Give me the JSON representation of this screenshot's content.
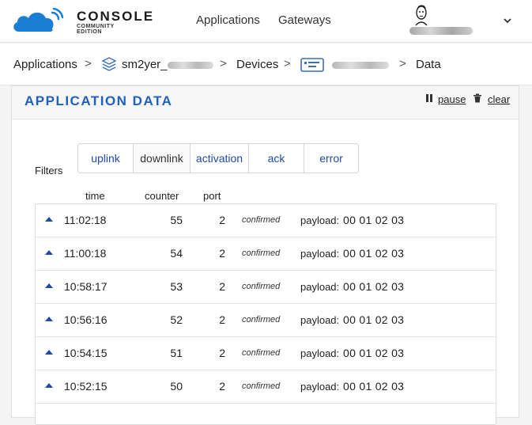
{
  "brand": {
    "title": "CONSOLE",
    "sub1": "COMMUNITY",
    "sub2": "EDITION",
    "accent": "#1a7fd4"
  },
  "nav": {
    "applications": "Applications",
    "gateways": "Gateways"
  },
  "breadcrumb": {
    "applications": "Applications",
    "app_id": "sm2yer_",
    "devices": "Devices",
    "data": "Data"
  },
  "panel": {
    "title": "APPLICATION DATA",
    "pause": "pause",
    "clear": "clear",
    "title_color": "#2060c0"
  },
  "filters": {
    "label": "Filters",
    "options": [
      "uplink",
      "downlink",
      "activation",
      "ack",
      "error"
    ],
    "active": "downlink"
  },
  "columns": {
    "time": "time",
    "counter": "counter",
    "port": "port"
  },
  "rows": [
    {
      "time": "11:02:18",
      "counter": "55",
      "port": "2",
      "confirmed": "confirmed",
      "payload_label": "payload:",
      "payload": "00 01 02 03"
    },
    {
      "time": "11:00:18",
      "counter": "54",
      "port": "2",
      "confirmed": "confirmed",
      "payload_label": "payload:",
      "payload": "00 01 02 03"
    },
    {
      "time": "10:58:17",
      "counter": "53",
      "port": "2",
      "confirmed": "confirmed",
      "payload_label": "payload:",
      "payload": "00 01 02 03"
    },
    {
      "time": "10:56:16",
      "counter": "52",
      "port": "2",
      "confirmed": "confirmed",
      "payload_label": "payload:",
      "payload": "00 01 02 03"
    },
    {
      "time": "10:54:15",
      "counter": "51",
      "port": "2",
      "confirmed": "confirmed",
      "payload_label": "payload:",
      "payload": "00 01 02 03"
    },
    {
      "time": "10:52:15",
      "counter": "50",
      "port": "2",
      "confirmed": "confirmed",
      "payload_label": "payload:",
      "payload": "00 01 02 03"
    }
  ]
}
